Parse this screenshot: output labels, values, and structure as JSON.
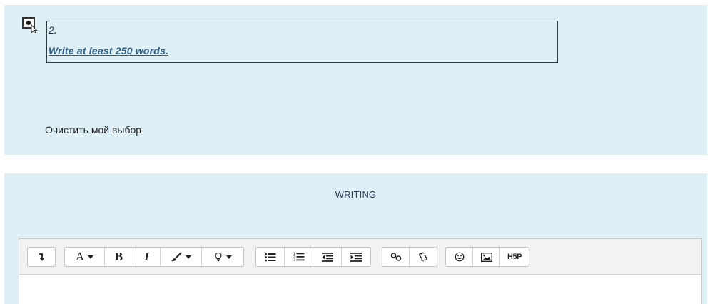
{
  "question": {
    "answer_number": "2.",
    "answer_text": "Write at least 250 words.",
    "clear_label": "Очистить мой выбор"
  },
  "writing": {
    "title": "WRITING"
  },
  "toolbar": {
    "icons": {
      "collapse": "arrow-down-icon",
      "font": "font-size-icon",
      "bold": "bold-icon",
      "italic": "italic-icon",
      "brush": "brush-icon",
      "bulb": "lightbulb-icon",
      "ul": "bullet-list-icon",
      "ol": "numbered-list-icon",
      "outdent": "outdent-icon",
      "indent": "indent-icon",
      "link": "link-icon",
      "unlink": "unlink-icon",
      "emoji": "emoji-icon",
      "image": "image-icon",
      "h5p": "h5p-icon"
    },
    "font_label": "A",
    "bold_label": "B",
    "italic_label": "I",
    "h5p_label": "H5P"
  },
  "colors": {
    "panel_bg": "#def0f6",
    "answer_link": "#2d5f84"
  }
}
